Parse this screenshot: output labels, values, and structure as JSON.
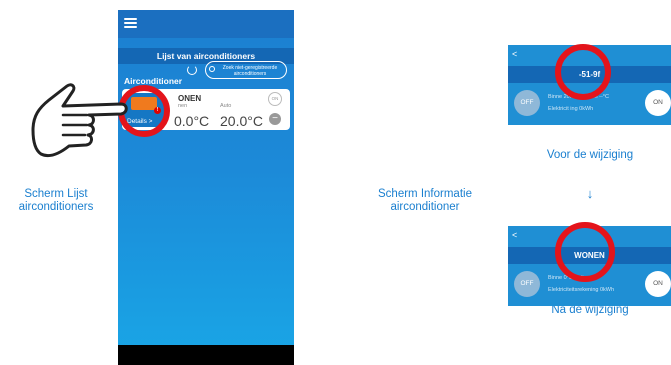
{
  "phone": {
    "title": "Lijst van airconditioners",
    "airconditioner_label": "Airconditioner",
    "search_unregistered_label": "Zoek niet-geregistreerde airconditioners",
    "device": {
      "name": "ONEN",
      "indoor_label": "nen",
      "mode_label": "Auto",
      "indoor_temp": "0.0°C",
      "set_temp": "20.0°C",
      "details_label": "Details  >",
      "alert_badge": "!",
      "on_label": "ON",
      "minus_label": "−"
    }
  },
  "captions": {
    "list_screen": "Scherm Lijst airconditioners",
    "info_screen": "Scherm Informatie airconditioner",
    "before": "Voor de wijziging",
    "arrow": "↓",
    "after": "Na de wijziging"
  },
  "info_before": {
    "back": "<",
    "title": "-51-9f",
    "off_label": "OFF",
    "on_label": "ON",
    "line1": "Binne   20.0°C Buiten   --°C",
    "line2": "Elektricit         ing 0kWh"
  },
  "info_after": {
    "back": "<",
    "title": "WONEN",
    "off_label": "OFF",
    "on_label": "ON",
    "line1": "Binne   0°C Buite   --°C",
    "line2": "Elektriciteitsrekening 0kWh"
  },
  "colors": {
    "phone_blue": "#1c7fd0",
    "title_bar": "#1467b4",
    "highlight_ring": "#e3141b",
    "caption_blue": "#1a7fcf",
    "unit_orange": "#f07a1e"
  },
  "icons": [
    "menu-icon",
    "refresh-icon",
    "search-icon",
    "ac-unit-icon",
    "hand-pointer-icon"
  ]
}
